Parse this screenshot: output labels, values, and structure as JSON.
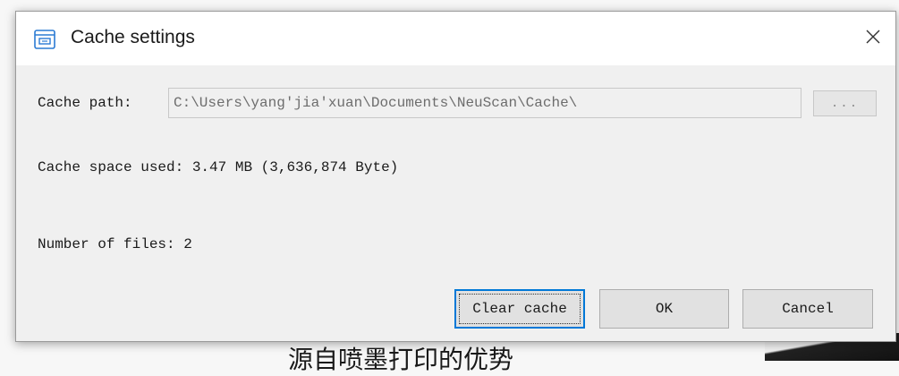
{
  "dialog": {
    "title": "Cache settings",
    "title_icon": "window-settings-icon",
    "close_glyph": "✕"
  },
  "cache_path": {
    "label": "Cache path:",
    "value": "C:\\Users\\yang'jia'xuan\\Documents\\NeuScan\\Cache\\",
    "browse_label": "..."
  },
  "stats": {
    "space_used": "Cache space used: 3.47 MB (3,636,874 Byte)",
    "file_count": "Number of files: 2"
  },
  "buttons": {
    "clear": "Clear cache",
    "ok": "OK",
    "cancel": "Cancel"
  },
  "background": {
    "partial_text": "源自喷墨打印的优势"
  },
  "colors": {
    "accent": "#0078d7",
    "dialog_bg": "#f0f0f0",
    "titlebar_bg": "#ffffff"
  }
}
